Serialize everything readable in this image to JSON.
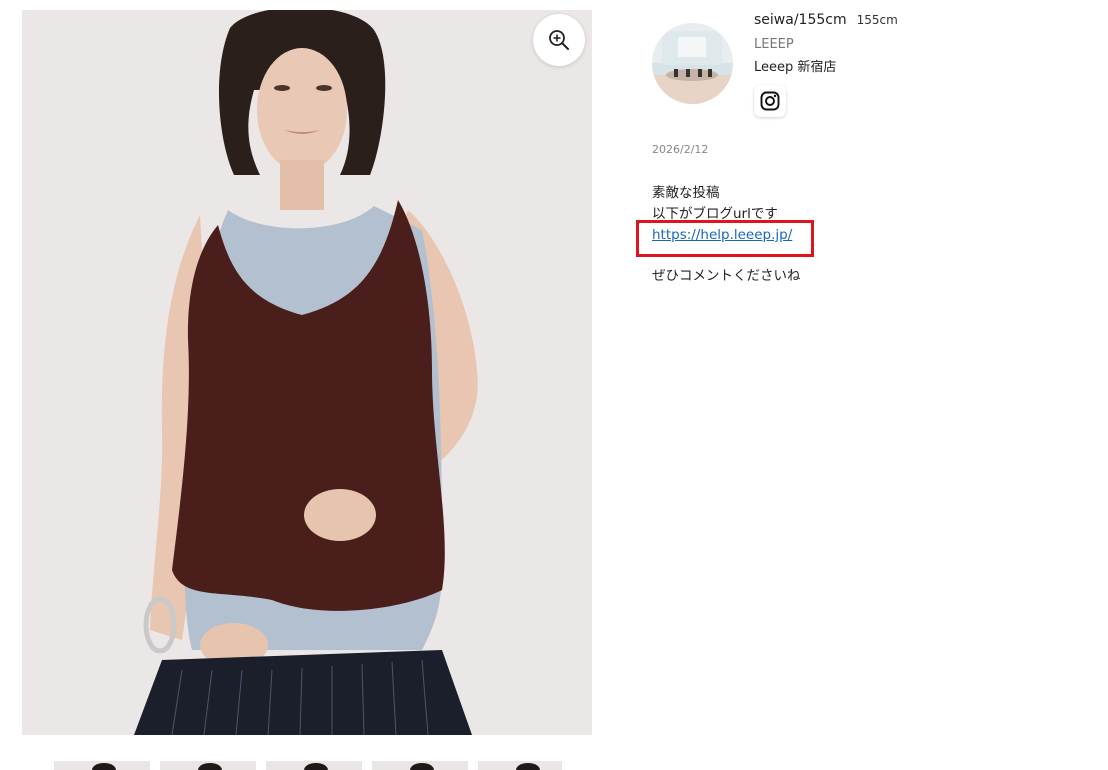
{
  "gallery": {
    "zoom_icon": "zoom-in-icon",
    "thumbnail_count": 5
  },
  "profile": {
    "name": "seiwa/155cm",
    "height": "155cm",
    "brand": "LEEEP",
    "shop": "Leeep 新宿店",
    "social_icon": "instagram-icon"
  },
  "post": {
    "date": "2026/2/12",
    "line1": "素敵な投稿",
    "line2": "以下がブログurlです",
    "link": "https://help.leeep.jp/",
    "line4": "ぜひコメントくださいね"
  },
  "colors": {
    "link": "#1a66c2",
    "highlight": "#e0141e",
    "tank_top": "#4a1e1a",
    "inner_top": "#b3c0cf",
    "pants": "#1b1f2b"
  }
}
